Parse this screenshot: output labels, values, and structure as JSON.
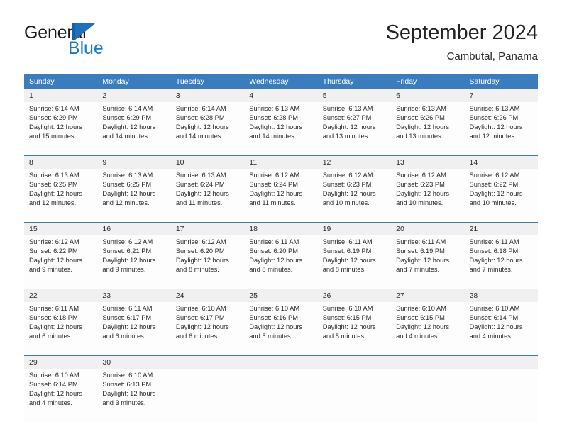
{
  "brand": {
    "name_part1": "General",
    "name_part2": "Blue",
    "mark": "triangle-logo"
  },
  "header": {
    "title": "September 2024",
    "subtitle": "Cambutal, Panama"
  },
  "colors": {
    "header_blue": "#3a7cbd",
    "brand_blue": "#1f7ac4",
    "daynum_bg": "#f0f0f0",
    "text": "#2b2b2b"
  },
  "weekdays": [
    "Sunday",
    "Monday",
    "Tuesday",
    "Wednesday",
    "Thursday",
    "Friday",
    "Saturday"
  ],
  "weeks": [
    {
      "days": [
        {
          "num": "1",
          "sunrise": "Sunrise: 6:14 AM",
          "sunset": "Sunset: 6:29 PM",
          "daylight1": "Daylight: 12 hours",
          "daylight2": "and 15 minutes."
        },
        {
          "num": "2",
          "sunrise": "Sunrise: 6:14 AM",
          "sunset": "Sunset: 6:29 PM",
          "daylight1": "Daylight: 12 hours",
          "daylight2": "and 14 minutes."
        },
        {
          "num": "3",
          "sunrise": "Sunrise: 6:14 AM",
          "sunset": "Sunset: 6:28 PM",
          "daylight1": "Daylight: 12 hours",
          "daylight2": "and 14 minutes."
        },
        {
          "num": "4",
          "sunrise": "Sunrise: 6:13 AM",
          "sunset": "Sunset: 6:28 PM",
          "daylight1": "Daylight: 12 hours",
          "daylight2": "and 14 minutes."
        },
        {
          "num": "5",
          "sunrise": "Sunrise: 6:13 AM",
          "sunset": "Sunset: 6:27 PM",
          "daylight1": "Daylight: 12 hours",
          "daylight2": "and 13 minutes."
        },
        {
          "num": "6",
          "sunrise": "Sunrise: 6:13 AM",
          "sunset": "Sunset: 6:26 PM",
          "daylight1": "Daylight: 12 hours",
          "daylight2": "and 13 minutes."
        },
        {
          "num": "7",
          "sunrise": "Sunrise: 6:13 AM",
          "sunset": "Sunset: 6:26 PM",
          "daylight1": "Daylight: 12 hours",
          "daylight2": "and 12 minutes."
        }
      ]
    },
    {
      "days": [
        {
          "num": "8",
          "sunrise": "Sunrise: 6:13 AM",
          "sunset": "Sunset: 6:25 PM",
          "daylight1": "Daylight: 12 hours",
          "daylight2": "and 12 minutes."
        },
        {
          "num": "9",
          "sunrise": "Sunrise: 6:13 AM",
          "sunset": "Sunset: 6:25 PM",
          "daylight1": "Daylight: 12 hours",
          "daylight2": "and 12 minutes."
        },
        {
          "num": "10",
          "sunrise": "Sunrise: 6:13 AM",
          "sunset": "Sunset: 6:24 PM",
          "daylight1": "Daylight: 12 hours",
          "daylight2": "and 11 minutes."
        },
        {
          "num": "11",
          "sunrise": "Sunrise: 6:12 AM",
          "sunset": "Sunset: 6:24 PM",
          "daylight1": "Daylight: 12 hours",
          "daylight2": "and 11 minutes."
        },
        {
          "num": "12",
          "sunrise": "Sunrise: 6:12 AM",
          "sunset": "Sunset: 6:23 PM",
          "daylight1": "Daylight: 12 hours",
          "daylight2": "and 10 minutes."
        },
        {
          "num": "13",
          "sunrise": "Sunrise: 6:12 AM",
          "sunset": "Sunset: 6:23 PM",
          "daylight1": "Daylight: 12 hours",
          "daylight2": "and 10 minutes."
        },
        {
          "num": "14",
          "sunrise": "Sunrise: 6:12 AM",
          "sunset": "Sunset: 6:22 PM",
          "daylight1": "Daylight: 12 hours",
          "daylight2": "and 10 minutes."
        }
      ]
    },
    {
      "days": [
        {
          "num": "15",
          "sunrise": "Sunrise: 6:12 AM",
          "sunset": "Sunset: 6:22 PM",
          "daylight1": "Daylight: 12 hours",
          "daylight2": "and 9 minutes."
        },
        {
          "num": "16",
          "sunrise": "Sunrise: 6:12 AM",
          "sunset": "Sunset: 6:21 PM",
          "daylight1": "Daylight: 12 hours",
          "daylight2": "and 9 minutes."
        },
        {
          "num": "17",
          "sunrise": "Sunrise: 6:12 AM",
          "sunset": "Sunset: 6:20 PM",
          "daylight1": "Daylight: 12 hours",
          "daylight2": "and 8 minutes."
        },
        {
          "num": "18",
          "sunrise": "Sunrise: 6:11 AM",
          "sunset": "Sunset: 6:20 PM",
          "daylight1": "Daylight: 12 hours",
          "daylight2": "and 8 minutes."
        },
        {
          "num": "19",
          "sunrise": "Sunrise: 6:11 AM",
          "sunset": "Sunset: 6:19 PM",
          "daylight1": "Daylight: 12 hours",
          "daylight2": "and 8 minutes."
        },
        {
          "num": "20",
          "sunrise": "Sunrise: 6:11 AM",
          "sunset": "Sunset: 6:19 PM",
          "daylight1": "Daylight: 12 hours",
          "daylight2": "and 7 minutes."
        },
        {
          "num": "21",
          "sunrise": "Sunrise: 6:11 AM",
          "sunset": "Sunset: 6:18 PM",
          "daylight1": "Daylight: 12 hours",
          "daylight2": "and 7 minutes."
        }
      ]
    },
    {
      "days": [
        {
          "num": "22",
          "sunrise": "Sunrise: 6:11 AM",
          "sunset": "Sunset: 6:18 PM",
          "daylight1": "Daylight: 12 hours",
          "daylight2": "and 6 minutes."
        },
        {
          "num": "23",
          "sunrise": "Sunrise: 6:11 AM",
          "sunset": "Sunset: 6:17 PM",
          "daylight1": "Daylight: 12 hours",
          "daylight2": "and 6 minutes."
        },
        {
          "num": "24",
          "sunrise": "Sunrise: 6:10 AM",
          "sunset": "Sunset: 6:17 PM",
          "daylight1": "Daylight: 12 hours",
          "daylight2": "and 6 minutes."
        },
        {
          "num": "25",
          "sunrise": "Sunrise: 6:10 AM",
          "sunset": "Sunset: 6:16 PM",
          "daylight1": "Daylight: 12 hours",
          "daylight2": "and 5 minutes."
        },
        {
          "num": "26",
          "sunrise": "Sunrise: 6:10 AM",
          "sunset": "Sunset: 6:15 PM",
          "daylight1": "Daylight: 12 hours",
          "daylight2": "and 5 minutes."
        },
        {
          "num": "27",
          "sunrise": "Sunrise: 6:10 AM",
          "sunset": "Sunset: 6:15 PM",
          "daylight1": "Daylight: 12 hours",
          "daylight2": "and 4 minutes."
        },
        {
          "num": "28",
          "sunrise": "Sunrise: 6:10 AM",
          "sunset": "Sunset: 6:14 PM",
          "daylight1": "Daylight: 12 hours",
          "daylight2": "and 4 minutes."
        }
      ]
    },
    {
      "days": [
        {
          "num": "29",
          "sunrise": "Sunrise: 6:10 AM",
          "sunset": "Sunset: 6:14 PM",
          "daylight1": "Daylight: 12 hours",
          "daylight2": "and 4 minutes."
        },
        {
          "num": "30",
          "sunrise": "Sunrise: 6:10 AM",
          "sunset": "Sunset: 6:13 PM",
          "daylight1": "Daylight: 12 hours",
          "daylight2": "and 3 minutes."
        },
        {
          "num": "",
          "sunrise": "",
          "sunset": "",
          "daylight1": "",
          "daylight2": ""
        },
        {
          "num": "",
          "sunrise": "",
          "sunset": "",
          "daylight1": "",
          "daylight2": ""
        },
        {
          "num": "",
          "sunrise": "",
          "sunset": "",
          "daylight1": "",
          "daylight2": ""
        },
        {
          "num": "",
          "sunrise": "",
          "sunset": "",
          "daylight1": "",
          "daylight2": ""
        },
        {
          "num": "",
          "sunrise": "",
          "sunset": "",
          "daylight1": "",
          "daylight2": ""
        }
      ]
    }
  ]
}
